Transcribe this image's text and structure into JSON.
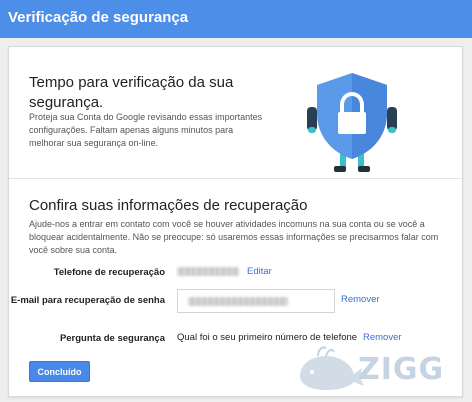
{
  "header": {
    "title": "Verificação de segurança",
    "color": "#4d8ee8"
  },
  "intro": {
    "title": "Tempo para verificação da sua segurança.",
    "description": "Proteja sua Conta do Google revisando essas importantes configurações. Faltam apenas alguns minutos para melhorar sua segurança on-line.",
    "illustration": "shield-lock-icon"
  },
  "recovery": {
    "title": "Confira suas informações de recuperação",
    "description": "Ajude-nos a entrar em contato com você se houver atividades incomuns na sua conta ou se você a bloquear acidentalmente. Não se preocupe: só usaremos essas informações se precisarmos falar com você sobre sua conta.",
    "phone": {
      "label": "Telefone de recuperação",
      "action": "Editar"
    },
    "email": {
      "label": "E-mail para recuperação de senha",
      "action": "Remover"
    },
    "question": {
      "label": "Pergunta de segurança",
      "value": "Qual foi o seu primeiro número de telefone",
      "action": "Remover"
    }
  },
  "done_button": "Concluído",
  "watermark": "ZIGG",
  "colors": {
    "accent": "#4788e8",
    "link": "#3b6fd8"
  }
}
